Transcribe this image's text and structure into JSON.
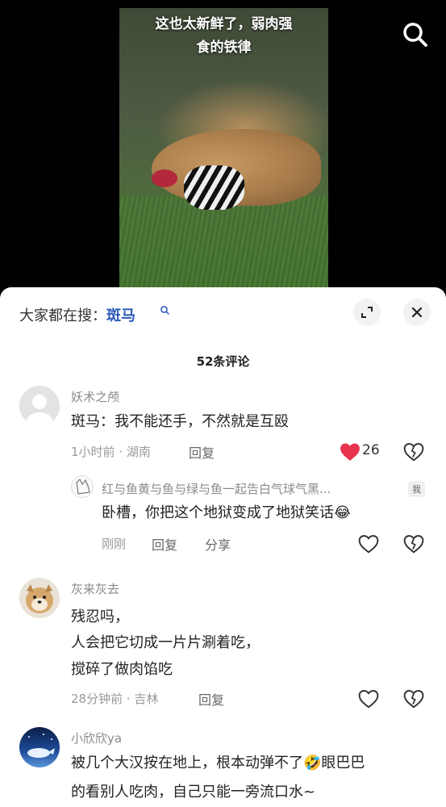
{
  "video": {
    "caption_line1": "这也太新鲜了，弱肉强",
    "caption_line2": "食的铁律"
  },
  "icons": {
    "search": "search-icon",
    "expand": "expand-icon",
    "close": "close-icon",
    "like": "heart-icon",
    "dislike": "broken-heart-icon"
  },
  "colors": {
    "accent_blue": "#2a59b8",
    "like_red": "#e8344e"
  },
  "sheet": {
    "trending_prefix": "大家都在搜：",
    "trending_term": "斑马",
    "comment_count": "52条评论"
  },
  "comments": [
    {
      "username": "妖术之颅",
      "content": "斑马：我不能还手，不然就是互殴",
      "time": "1小时前 · 湖南",
      "reply_label": "回复",
      "likes": "26",
      "liked": true,
      "replies": [
        {
          "username": "红与鱼黄与鱼与绿与鱼一起告白气球气黑...",
          "badge": "我",
          "content": "卧槽，你把这个地狱变成了地狱笑话",
          "emoji": "😂",
          "time": "刚刚",
          "reply_label": "回复",
          "share_label": "分享"
        }
      ]
    },
    {
      "username": "灰来灰去",
      "content_lines": [
        "残忍吗，",
        "人会把它切成一片片涮着吃，",
        "搅碎了做肉馅吃"
      ],
      "time": "28分钟前 · 吉林",
      "reply_label": "回复"
    },
    {
      "username": "小欣欣ya",
      "content_line1_a": "被几个大汉按在地上，根本动弹不了",
      "emoji": "🤣",
      "content_line1_b": "眼巴巴",
      "content_line2": "的看别人吃肉，自己只能一旁流口水~"
    }
  ]
}
